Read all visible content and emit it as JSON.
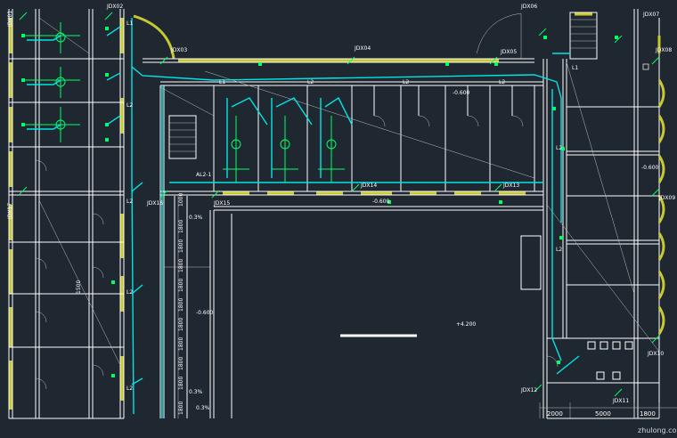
{
  "drawing": {
    "colors": {
      "background": "#1f2731",
      "wall": "#ffffff",
      "window": "#c8c830",
      "pipe": "#00e5e5",
      "fixture": "#00ff66"
    },
    "room_labels": [
      {
        "id": "jdx01",
        "text": "JDX01"
      },
      {
        "id": "jdx02",
        "text": "JDX02"
      },
      {
        "id": "jdx03",
        "text": "JDX03"
      },
      {
        "id": "jdx04",
        "text": "JDX04"
      },
      {
        "id": "jdx05",
        "text": "JDX05"
      },
      {
        "id": "jdx06",
        "text": "JDX06"
      },
      {
        "id": "jdx07",
        "text": "JDX07"
      },
      {
        "id": "jdx08",
        "text": "JDX08"
      },
      {
        "id": "jdx09",
        "text": "JDX09"
      },
      {
        "id": "jdx10",
        "text": "JDX10"
      },
      {
        "id": "jdx11",
        "text": "JDX11"
      },
      {
        "id": "jdx12",
        "text": "JDX12"
      },
      {
        "id": "jdx13",
        "text": "JDX13"
      },
      {
        "id": "jdx14",
        "text": "JDX14"
      },
      {
        "id": "jdx15",
        "text": "JDX15"
      },
      {
        "id": "jdx16",
        "text": "JDX16"
      },
      {
        "id": "jdx17",
        "text": "JDX17"
      }
    ],
    "line_labels": {
      "l1a": "L1",
      "l1b": "L1",
      "l1c": "L1",
      "l2a": "L2",
      "l2b": "L2",
      "l2c": "L2",
      "l2d": "L2",
      "l2e": "L2",
      "l2f": "L2",
      "l2g": "L2",
      "l2h": "L2",
      "l2i": "L2"
    },
    "panel_label": "AL2-1",
    "slopes": {
      "s1": "0.3%",
      "s2": "0.3%",
      "s3": "0.3%"
    },
    "elevations": {
      "e1": "-0.600",
      "e2": "-0.600",
      "e3": "-0.600",
      "e4": "+4.200",
      "e5": "-0.600"
    },
    "dimension_column": [
      "1000",
      "1800",
      "1800",
      "1800",
      "1800",
      "1800",
      "1800",
      "1800",
      "1800",
      "1800",
      "1800"
    ],
    "side_dim": "1500",
    "bottom_dims": {
      "d1": "2000",
      "d2": "5000",
      "d3": "1800"
    },
    "watermark": "zhulong.com"
  }
}
